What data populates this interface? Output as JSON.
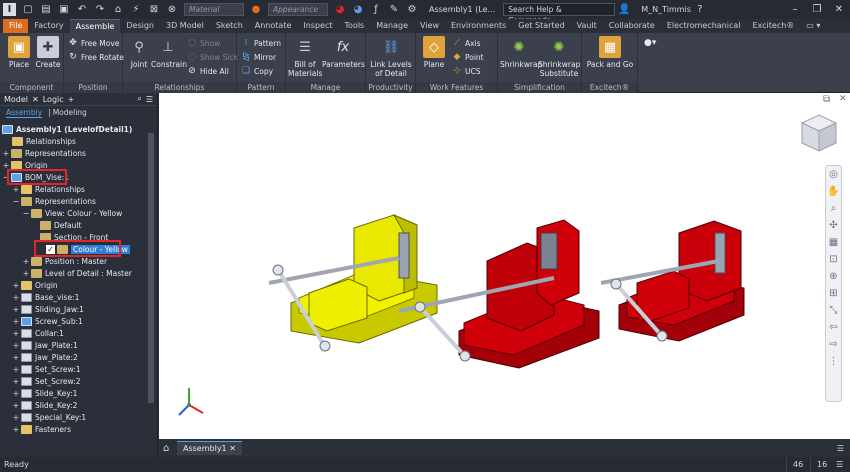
{
  "qat": {
    "logo": "I",
    "material_placeholder": "Material",
    "appearance_placeholder": "Appearance",
    "title": "Assembly1 (Le...",
    "search": "Search Help & Commands...",
    "user": "M_N_Timmis"
  },
  "tabs": [
    "File",
    "Factory",
    "Assemble",
    "Design",
    "3D Model",
    "Sketch",
    "Annotate",
    "Inspect",
    "Tools",
    "Manage",
    "View",
    "Environments",
    "Get Started",
    "Vault",
    "Collaborate",
    "Electromechanical",
    "Excitech®"
  ],
  "ribbon": {
    "component": {
      "title": "Component",
      "place": "Place",
      "create": "Create"
    },
    "position": {
      "title": "Position",
      "free_move": "Free Move",
      "free_rotate": "Free Rotate"
    },
    "relationships": {
      "title": "Relationships",
      "joint": "Joint",
      "constrain": "Constrain",
      "show": "Show",
      "show_sick": "Show Sick",
      "hide_all": "Hide All"
    },
    "pattern": {
      "title": "Pattern",
      "pattern": "Pattern",
      "mirror": "Mirror",
      "copy": "Copy"
    },
    "manage": {
      "title": "Manage",
      "bom": "Bill of Materials",
      "params": "Parameters"
    },
    "productivity": {
      "title": "Productivity",
      "link": "Link Levels of Detail"
    },
    "work_features": {
      "title": "Work Features",
      "plane": "Plane",
      "axis": "Axis",
      "point": "Point",
      "ucs": "UCS"
    },
    "simplification": {
      "title": "Simplification",
      "shrinkwrap": "Shrinkwrap",
      "shrinkwrap_sub": "Shrinkwrap Substitute"
    },
    "excitech": {
      "title": "Excitech®",
      "pack": "Pack and Go"
    }
  },
  "browser": {
    "tab_model": "Model",
    "tab_logic": "Logic",
    "sub_assembly": "Assembly",
    "sub_modeling": "Modeling",
    "rows": [
      "Assembly1 (LevelofDetail1)",
      "Relationships",
      "Representations",
      "Origin",
      "BOM_Vise:1",
      "Relationships",
      "Representations",
      "View: Colour - Yellow",
      "Default",
      "Section - Front",
      "Colour - Yellow",
      "Position : Master",
      "Level of Detail : Master",
      "Origin",
      "Base_vise:1",
      "Sliding_Jaw:1",
      "Screw_Sub:1",
      "Collar:1",
      "Jaw_Plate:1",
      "Jaw_Plate:2",
      "Set_Screw:1",
      "Set_Screw:2",
      "Slide_Key:1",
      "Slide_Key:2",
      "Special_Key:1",
      "Fasteners"
    ]
  },
  "document_tab": "Assembly1",
  "status": {
    "ready": "Ready",
    "n1": "46",
    "n2": "16"
  },
  "colors": {
    "accent": "#e06c1d",
    "yellow_vise": "#e8e800",
    "red_vise": "#d0000a",
    "highlight": "#e0262b"
  }
}
